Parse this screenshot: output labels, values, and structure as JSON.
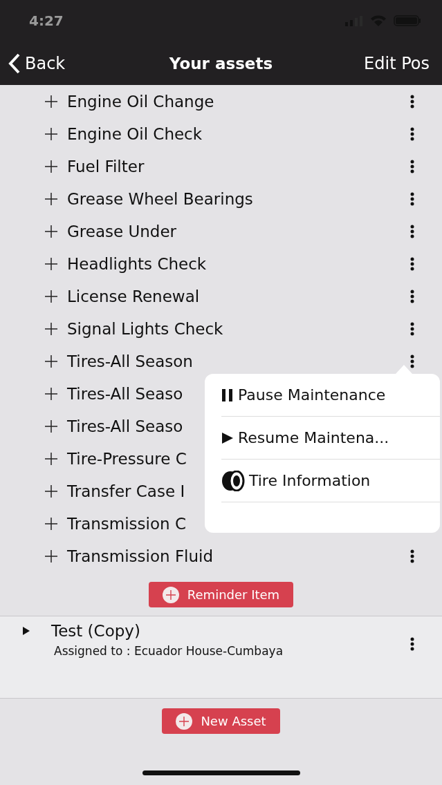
{
  "status_bar": {
    "time": "4:27"
  },
  "nav": {
    "back": "Back",
    "title": "Your assets",
    "action": "Edit Pos"
  },
  "items": [
    {
      "label": "Engine Oil Change"
    },
    {
      "label": "Engine Oil Check"
    },
    {
      "label": "Fuel Filter"
    },
    {
      "label": "Grease Wheel Bearings"
    },
    {
      "label": "Grease Under"
    },
    {
      "label": "Headlights Check"
    },
    {
      "label": "License Renewal"
    },
    {
      "label": "Signal Lights Check"
    },
    {
      "label": "Tires-All Season",
      "popup": {
        "items": [
          {
            "kind": "pause",
            "label": "Pause Maintenance"
          },
          {
            "kind": "play",
            "label": "Resume Maintena..."
          },
          {
            "kind": "tire",
            "label": "Tire Information"
          },
          {
            "kind": "empty"
          }
        ]
      }
    },
    {
      "label": "Tires-All Seaso"
    },
    {
      "label": "Tires-All Seaso"
    },
    {
      "label": "Tire-Pressure C"
    },
    {
      "label": "Transfer Case I"
    },
    {
      "label": "Transmission C"
    },
    {
      "label": "Transmission Fluid"
    }
  ],
  "reminder_button": "Reminder Item",
  "assets": [
    {
      "name": "Test (Copy)",
      "assigned": "Assigned to : Ecuador House-Cumbaya",
      "expanded": false
    }
  ],
  "new_asset_button": "New Asset"
}
